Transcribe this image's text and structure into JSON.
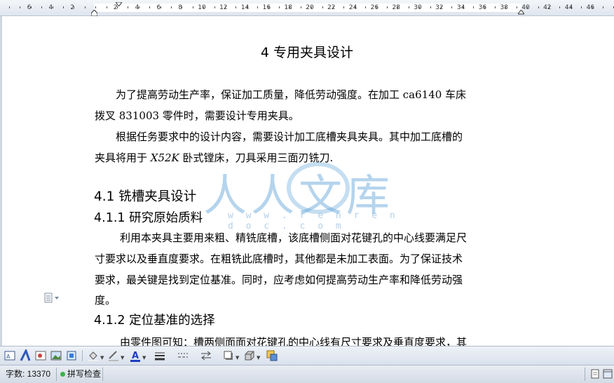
{
  "ruler": {
    "numbers": [
      "6",
      "4",
      "2",
      "2",
      "4",
      "6",
      "8",
      "10",
      "12",
      "14",
      "16",
      "18",
      "20",
      "22",
      "24",
      "26",
      "28",
      "30",
      "32",
      "34",
      "36",
      "38",
      "40",
      "42",
      "44",
      "46"
    ]
  },
  "document": {
    "title": "4  专用夹具设计",
    "intro_lines": [
      "为了提高劳动生产率，保证加工质量，降低劳动强度。在加工 ca6140 车床",
      "拨叉 831003 零件时，需要设计专用夹具。",
      "根据任务要求中的设计内容，需要设计加工底槽夹具夹具。其中加工底槽的"
    ],
    "intro_last": {
      "before": "夹具将用于 ",
      "italic": "X52K",
      "after": " 卧式镗床，刀具采用三面刃铣刀."
    },
    "section_41": "4.1  铣槽夹具设计",
    "section_411": "4.1.1  研究原始质料",
    "body_lines": [
      "利用本夹具主要用来粗、精铣底槽，该底槽侧面对花键孔的中心线要满足尺",
      "寸要求以及垂直度要求。在粗铣此底槽时，其他都是未加工表面。为了保证技术",
      "要求，最关键是找到定位基准。同时，应考虑如何提高劳动生产率和降低劳动强",
      "度。"
    ],
    "section_412": "4.1.2  定位基准的选择",
    "last_line": "由零件图可知：槽两侧面面对花键孔的中心线有尺寸要求及垂直度要求，其"
  },
  "watermark": {
    "text": "人人文库",
    "url": "w w w . r e n r e n d o c . c o m"
  },
  "toolbar": {
    "icons": [
      "textbox-icon",
      "wordart-icon",
      "clipart-icon",
      "picture-icon",
      "diagram-icon",
      "fill-color-icon",
      "line-color-icon",
      "font-color-icon",
      "line-style-icon",
      "dash-style-icon",
      "arrow-style-icon",
      "shadow-icon",
      "3d-icon",
      "select-objects-icon"
    ],
    "font_color": "#1f3fbf"
  },
  "status": {
    "word_count": "字数: 13370",
    "spell_check": "拼写检查"
  },
  "colors": {
    "ruler_bg": "#e3e8ef",
    "toolbar_bg": "#dfe6ef",
    "watermark": "#5aa0d7"
  }
}
